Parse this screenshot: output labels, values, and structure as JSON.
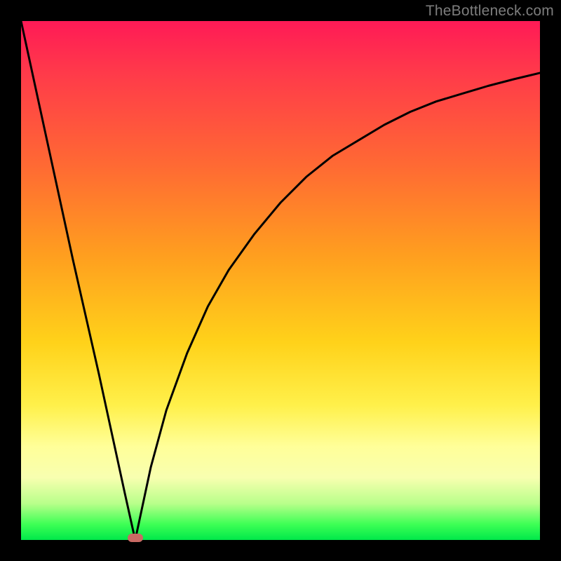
{
  "watermark": "TheBottleneck.com",
  "colors": {
    "frame_border": "#000000",
    "gradient_top": "#ff1a56",
    "gradient_mid1": "#ff9e1f",
    "gradient_mid2": "#ffff99",
    "gradient_bottom": "#00e84a",
    "curve_stroke": "#000000",
    "marker_fill": "#c96a64",
    "watermark_text": "#7d7d7d"
  },
  "chart_data": {
    "type": "line",
    "title": "",
    "xlabel": "",
    "ylabel": "",
    "xlim": [
      0,
      100
    ],
    "ylim": [
      0,
      100
    ],
    "grid": false,
    "legend": false,
    "annotations": [
      {
        "kind": "marker",
        "x": 22,
        "y": 0,
        "shape": "rounded-rect",
        "color": "#c96a64"
      }
    ],
    "series": [
      {
        "name": "left-branch",
        "x": [
          0,
          5,
          10,
          15,
          20,
          22
        ],
        "values": [
          100,
          77,
          54,
          32,
          9,
          0
        ]
      },
      {
        "name": "right-branch",
        "x": [
          22,
          25,
          28,
          32,
          36,
          40,
          45,
          50,
          55,
          60,
          65,
          70,
          75,
          80,
          85,
          90,
          95,
          100
        ],
        "values": [
          0,
          14,
          25,
          36,
          45,
          52,
          59,
          65,
          70,
          74,
          77,
          80,
          82.5,
          84.5,
          86,
          87.5,
          88.8,
          90
        ]
      }
    ]
  }
}
